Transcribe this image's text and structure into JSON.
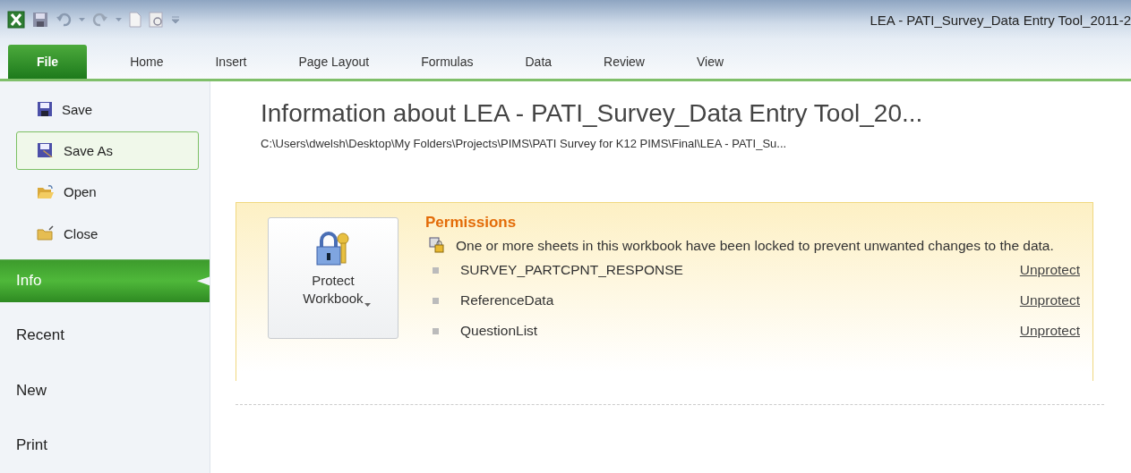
{
  "window": {
    "title": "LEA - PATI_Survey_Data Entry Tool_2011-2"
  },
  "ribbon_tabs": [
    {
      "label": "File",
      "selected": true
    },
    {
      "label": "Home",
      "selected": false
    },
    {
      "label": "Insert",
      "selected": false
    },
    {
      "label": "Page Layout",
      "selected": false
    },
    {
      "label": "Formulas",
      "selected": false
    },
    {
      "label": "Data",
      "selected": false
    },
    {
      "label": "Review",
      "selected": false
    },
    {
      "label": "View",
      "selected": false
    }
  ],
  "sidebar": {
    "items": [
      {
        "kind": "command",
        "label": "Save",
        "selected": false
      },
      {
        "kind": "command",
        "label": "Save As",
        "selected": true
      },
      {
        "kind": "command",
        "label": "Open",
        "selected": false
      },
      {
        "kind": "command",
        "label": "Close",
        "selected": false
      },
      {
        "kind": "tab",
        "label": "Info",
        "selected": true
      },
      {
        "kind": "tab",
        "label": "Recent",
        "selected": false
      },
      {
        "kind": "tab",
        "label": "New",
        "selected": false
      },
      {
        "kind": "tab",
        "label": "Print",
        "selected": false
      }
    ]
  },
  "info": {
    "title": "Information about LEA - PATI_Survey_Data Entry Tool_20...",
    "path": "C:\\Users\\dwelsh\\Desktop\\My Folders\\Projects\\PIMS\\PATI Survey for K12 PIMS\\Final\\LEA - PATI_Su...",
    "permissions": {
      "button": "Protect Workbook",
      "heading": "Permissions",
      "message": "One or more sheets in this workbook have been locked to prevent unwanted changes to the data.",
      "sheets": [
        {
          "name": "SURVEY_PARTCPNT_RESPONSE",
          "action": "Unprotect"
        },
        {
          "name": "ReferenceData",
          "action": "Unprotect"
        },
        {
          "name": "QuestionList",
          "action": "Unprotect"
        }
      ]
    }
  }
}
